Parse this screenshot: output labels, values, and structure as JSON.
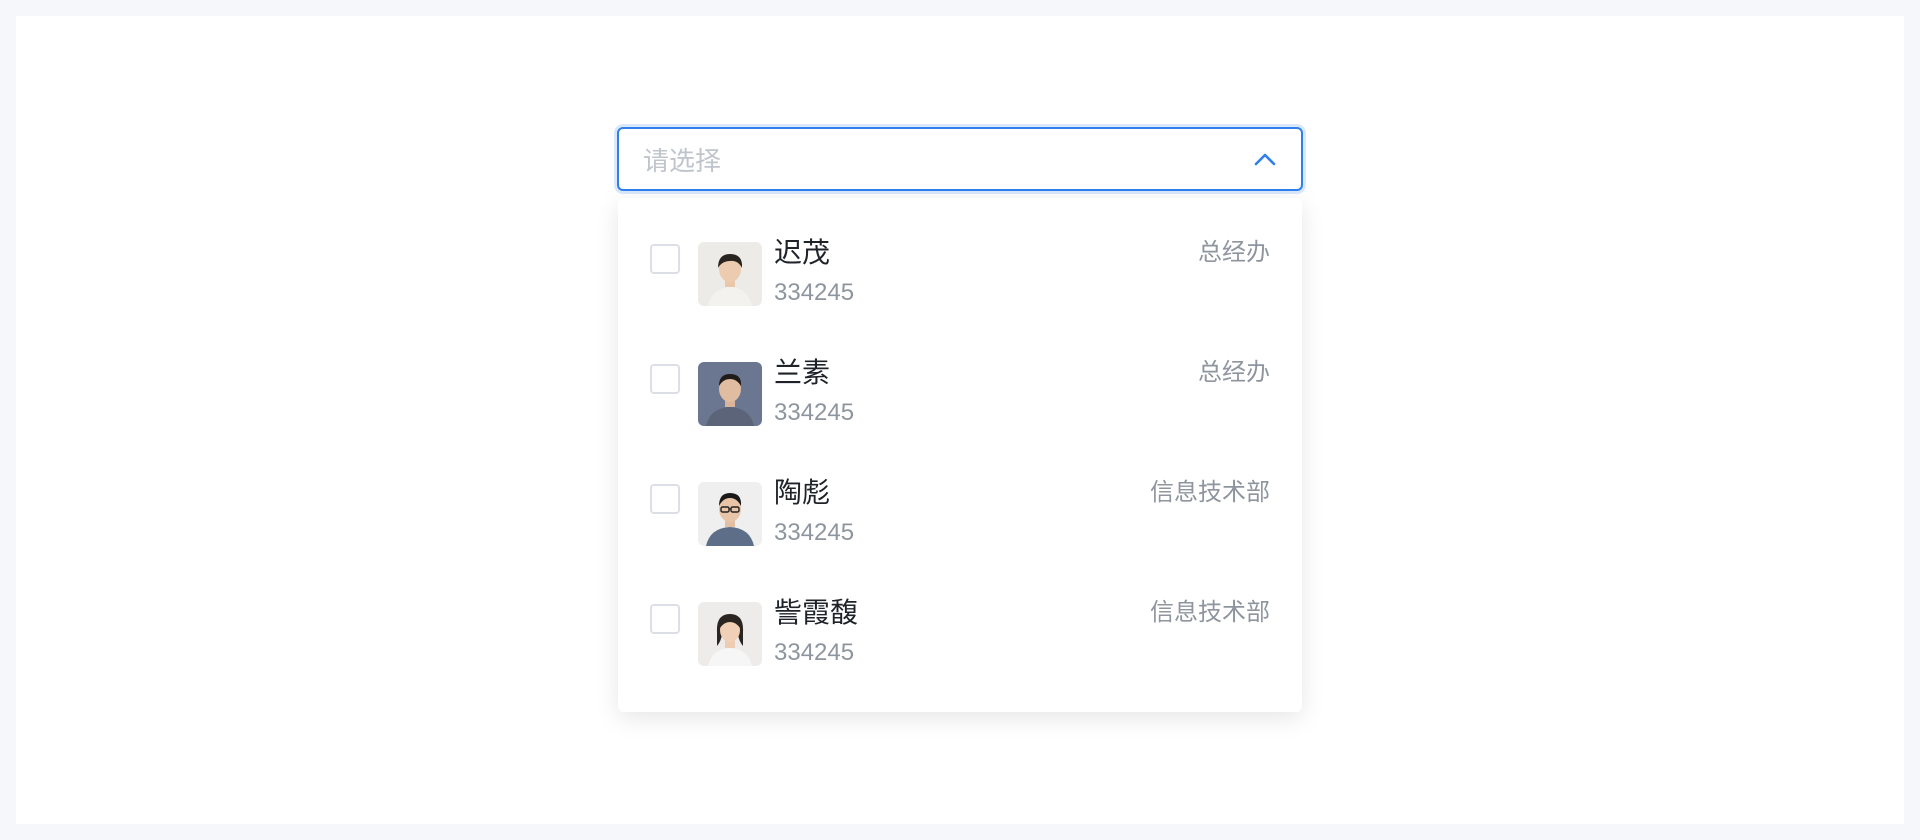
{
  "select": {
    "placeholder": "请选择",
    "icon": "chevron-up-icon",
    "accent_color": "#2f80ed"
  },
  "options": [
    {
      "name": "迟茂",
      "id": "334245",
      "dept": "总经办",
      "checked": false,
      "avatar": "avatar-photo"
    },
    {
      "name": "兰素",
      "id": "334245",
      "dept": "总经办",
      "checked": false,
      "avatar": "avatar-photo"
    },
    {
      "name": "陶彪",
      "id": "334245",
      "dept": "信息技术部",
      "checked": false,
      "avatar": "avatar-photo"
    },
    {
      "name": "訾霞馥",
      "id": "334245",
      "dept": "信息技术部",
      "checked": false,
      "avatar": "avatar-photo"
    }
  ]
}
